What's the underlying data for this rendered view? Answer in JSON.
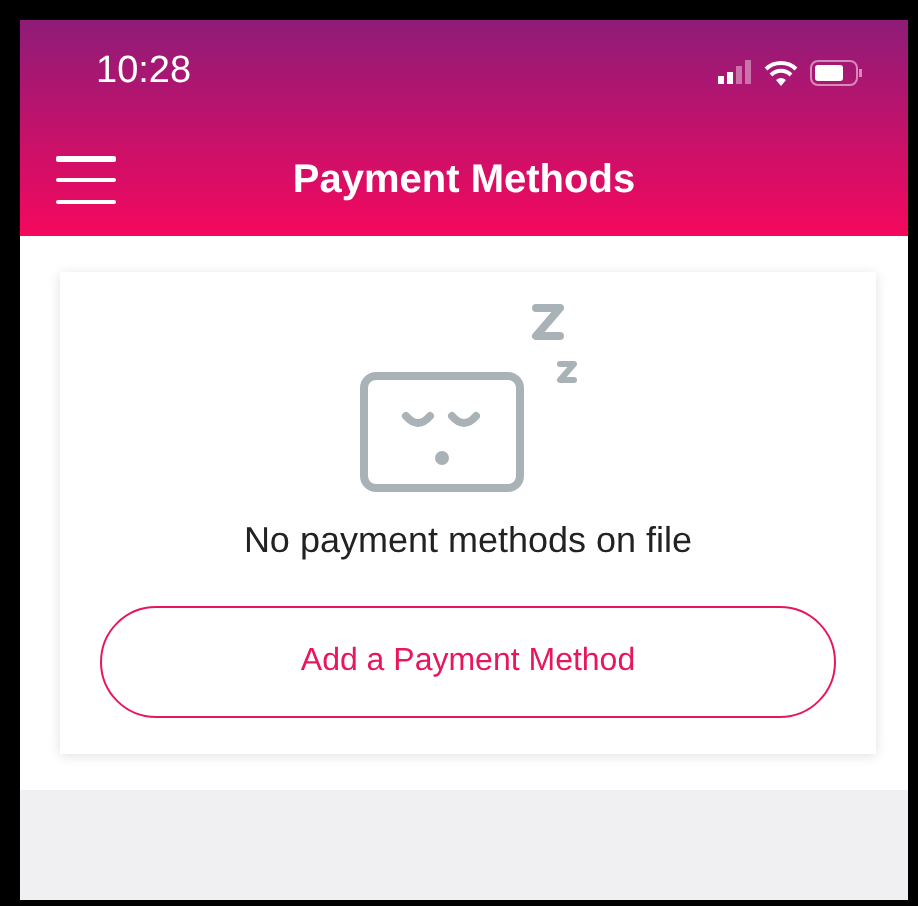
{
  "status_bar": {
    "time": "10:28"
  },
  "header": {
    "title": "Payment Methods"
  },
  "empty_state": {
    "message": "No payment methods on file",
    "button": "Add a Payment Method"
  }
}
